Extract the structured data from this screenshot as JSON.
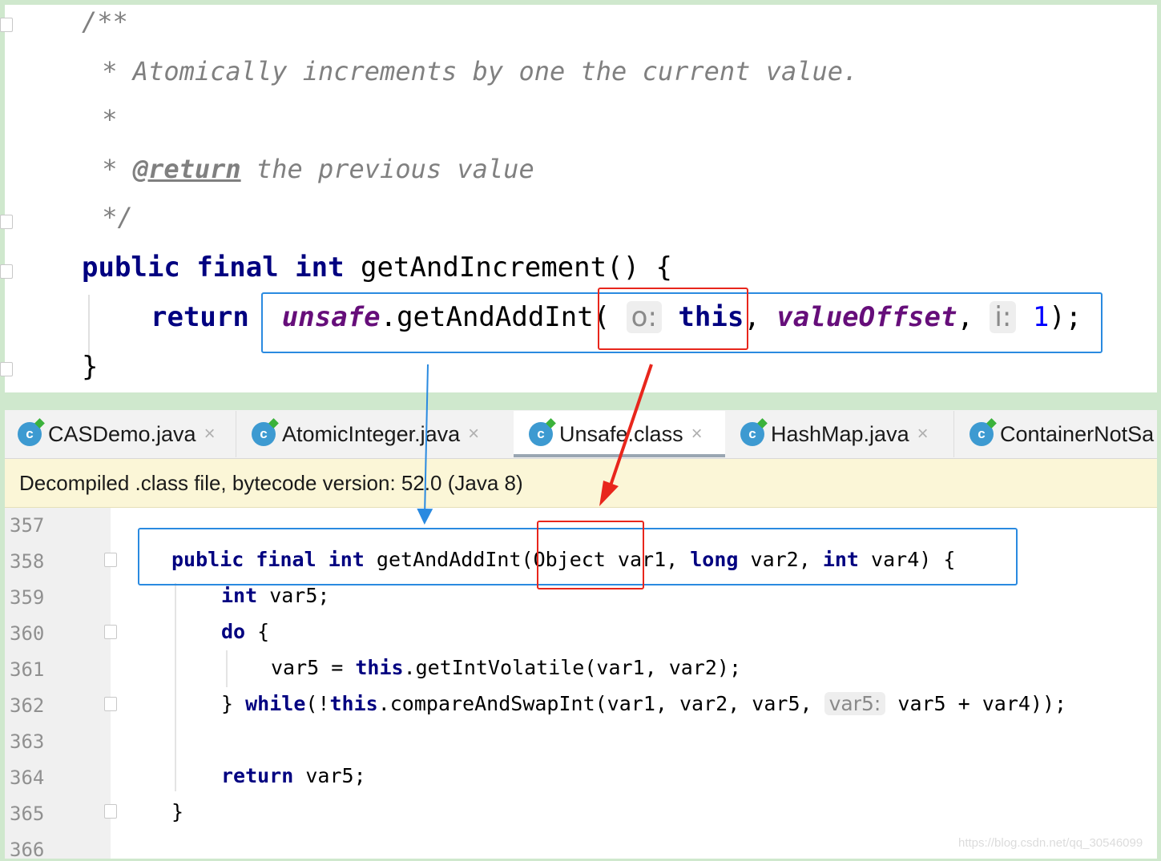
{
  "top_code": {
    "comment_open": "/**",
    "comment_line1": " * Atomically increments by one the current value.",
    "comment_star": " *",
    "comment_return_star": " * ",
    "comment_return_tag": "@return",
    "comment_return_text": " the previous value",
    "comment_close": " */",
    "method_kw1": "public",
    "method_kw2": "final",
    "method_kw3": "int",
    "method_name": " getAndIncrement() {",
    "return_kw": "return",
    "unsafe_field": "unsafe",
    "call": ".getAndAddInt(",
    "hint_o": "o:",
    "this_kw": "this",
    "comma1": ",",
    "offset_field": "valueOffset",
    "comma2": ",",
    "hint_i": "i:",
    "one": "1",
    "close_call": ");",
    "close_brace": "}"
  },
  "tabs": [
    {
      "label": "CASDemo.java"
    },
    {
      "label": "AtomicInteger.java"
    },
    {
      "label": "Unsafe.class"
    },
    {
      "label": "HashMap.java"
    },
    {
      "label": "ContainerNotSa"
    }
  ],
  "tab_close_glyph": "×",
  "tab_icon_letter": "c",
  "banner": "Decompiled .class file, bytecode version: 52.0 (Java 8)",
  "line_numbers": [
    "357",
    "358",
    "359",
    "360",
    "361",
    "362",
    "363",
    "364",
    "365",
    "366"
  ],
  "bottom_code": {
    "l358_kw1": "public",
    "l358_kw2": "final",
    "l358_kw3": "int",
    "l358_rest1": " getAndAddInt(Object var1, ",
    "l358_kw4": "long",
    "l358_rest2": " var2, ",
    "l358_kw5": "int",
    "l358_rest3": " var4) {",
    "l359_kw": "int",
    "l359_rest": " var5;",
    "l360_kw": "do",
    "l360_rest": " {",
    "l361_a": "var5 = ",
    "l361_kw": "this",
    "l361_b": ".getIntVolatile(var1, var2);",
    "l362_a": "} ",
    "l362_kw1": "while",
    "l362_b": "(!",
    "l362_kw2": "this",
    "l362_c": ".compareAndSwapInt(var1, var2, var5, ",
    "l362_hint": "var5:",
    "l362_d": " var5 + var4));",
    "l364_kw": "return",
    "l364_rest": " var5;",
    "l365": "}"
  },
  "watermark": "https://blog.csdn.net/qq_30546099",
  "colors": {
    "keyword": "#000080",
    "comment": "#808080",
    "field": "#660e7a",
    "number": "#0000ff",
    "highlight_blue": "#2a8ae0",
    "highlight_red": "#e8261c",
    "banner_bg": "#fbf6d7"
  }
}
